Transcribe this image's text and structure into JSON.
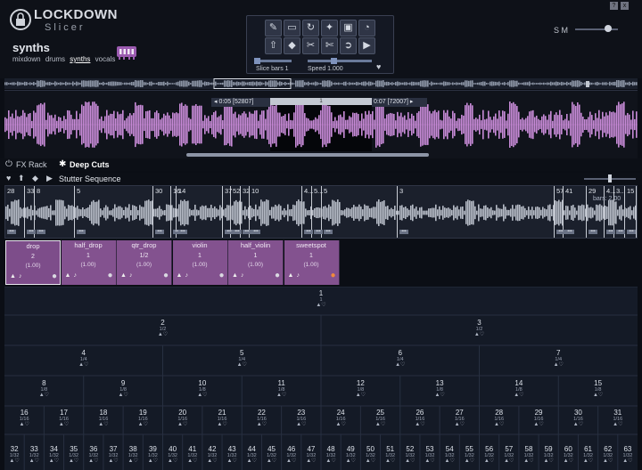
{
  "app": {
    "title": "LOCKDOWN",
    "subtitle": "Slicer"
  },
  "kit": {
    "name": "synths",
    "links": [
      "mixdown",
      "drums",
      "synths",
      "vocals"
    ],
    "active_link": "synths"
  },
  "toolbar": {
    "row1_icons": [
      "edit-icon",
      "open-folder-icon",
      "refresh-icon",
      "magic-wand-icon",
      "gift-icon",
      "stopwatch-icon"
    ],
    "row2_icons": [
      "upload-icon",
      "eraser-icon",
      "scissors-icon",
      "scissors-alt-icon",
      "arrow-right-circle-icon",
      "play-icon"
    ],
    "slice_bars_label": "Slice bars 1",
    "speed_label": "Speed 1.000"
  },
  "window": {
    "help": "?",
    "close": "x"
  },
  "sm": {
    "label": "S M"
  },
  "waveform": {
    "start_label": "0:05 [52807]",
    "end_label": "0:07 [72007]",
    "marker": "1"
  },
  "rack": {
    "fx_label": "FX Rack",
    "cuts_label": "Deep Cuts"
  },
  "stutter": {
    "label": "Stutter Sequence"
  },
  "slices": {
    "bars_label": "bars: 2.00",
    "items": [
      {
        "num": "28"
      },
      {
        "num": "33"
      },
      {
        "num": "8"
      },
      {
        "num": "5"
      },
      {
        "num": "30"
      },
      {
        "num": "16"
      },
      {
        "num": "14"
      },
      {
        "num": "37"
      },
      {
        "num": "52"
      },
      {
        "num": "32"
      },
      {
        "num": "10"
      },
      {
        "num": "4..."
      },
      {
        "num": "5..."
      },
      {
        "num": "5"
      },
      {
        "num": "3"
      },
      {
        "num": "57"
      },
      {
        "num": "41"
      },
      {
        "num": "29"
      },
      {
        "num": "4..."
      },
      {
        "num": "3..."
      },
      {
        "num": "15"
      }
    ]
  },
  "patterns": [
    {
      "name": "drop",
      "num": "2",
      "ratio": "(1.00)",
      "selected": true
    },
    {
      "name": "half_drop",
      "num": "1",
      "ratio": "(1.00)",
      "selected": false
    },
    {
      "name": "qtr_drop",
      "num": "1/2",
      "ratio": "(1.00)",
      "selected": false
    },
    {
      "name": "violin",
      "num": "1",
      "ratio": "(1.00)",
      "selected": false
    },
    {
      "name": "half_violin",
      "num": "1",
      "ratio": "(1.00)",
      "selected": false
    },
    {
      "name": "sweetspot",
      "num": "1",
      "ratio": "(1.00)",
      "selected": false
    }
  ],
  "tree": {
    "levels": [
      {
        "ratio": "1",
        "nodes": [
          "1"
        ]
      },
      {
        "ratio": "1/2",
        "nodes": [
          "2",
          "3"
        ]
      },
      {
        "ratio": "1/4",
        "nodes": [
          "4",
          "5",
          "6",
          "7"
        ]
      },
      {
        "ratio": "1/8",
        "nodes": [
          "8",
          "9",
          "10",
          "11",
          "12",
          "13",
          "14",
          "15"
        ]
      },
      {
        "ratio": "1/16",
        "nodes": [
          "16",
          "17",
          "18",
          "19",
          "20",
          "21",
          "22",
          "23",
          "24",
          "25",
          "26",
          "27",
          "28",
          "29",
          "30",
          "31"
        ]
      },
      {
        "ratio": "1/32",
        "nodes": [
          "32",
          "33",
          "34",
          "35",
          "36",
          "37",
          "38",
          "39",
          "40",
          "41",
          "42",
          "43",
          "44",
          "45",
          "46",
          "47",
          "48",
          "49",
          "50",
          "51",
          "52",
          "53",
          "54",
          "55",
          "56",
          "57",
          "58",
          "59",
          "60",
          "61",
          "62",
          "63"
        ]
      }
    ]
  },
  "colors": {
    "accent_purple": "#83528f",
    "wave_pink": "#c78ad6",
    "background": "#0b0e15"
  }
}
